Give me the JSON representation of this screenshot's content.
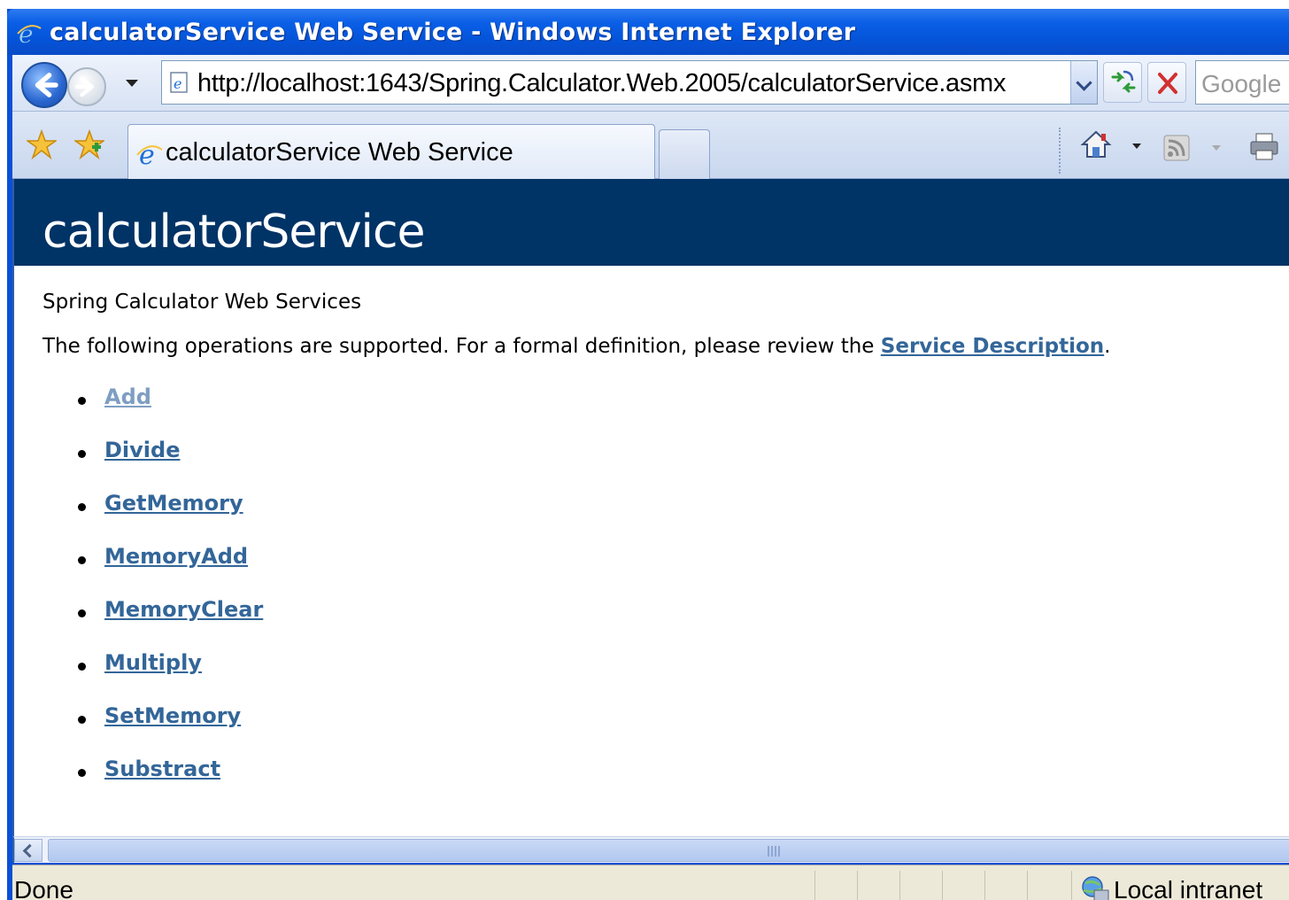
{
  "window": {
    "title": "calculatorService Web Service - Windows Internet Explorer"
  },
  "navbar": {
    "back_icon": "back-arrow-icon",
    "forward_icon": "forward-arrow-icon",
    "address": "http://localhost:1643/Spring.Calculator.Web.2005/calculatorService.asmx",
    "search_placeholder": "Google"
  },
  "tabbar": {
    "active_tab": "calculatorService Web Service"
  },
  "page": {
    "banner_title": "calculatorService",
    "subtitle": "Spring Calculator Web Services",
    "intro_prefix": "The following operations are supported. For a formal definition, please review the ",
    "intro_link": "Service Description",
    "intro_suffix": ".",
    "operations": [
      "Add",
      "Divide",
      "GetMemory",
      "MemoryAdd",
      "MemoryClear",
      "Multiply",
      "SetMemory",
      "Substract"
    ]
  },
  "statusbar": {
    "status": "Done",
    "zone": "Local intranet"
  },
  "colors": {
    "banner": "#003366",
    "link": "#336699",
    "link_visited": "#7e9ec2",
    "titlebar": "#0453d8"
  }
}
